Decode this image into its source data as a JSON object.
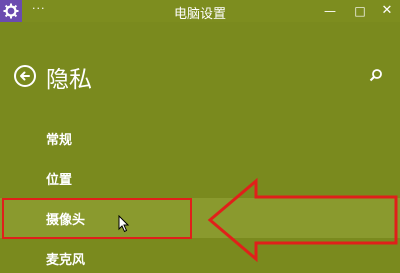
{
  "window": {
    "title": "电脑设置",
    "sys_menu": "···",
    "minimize": "—",
    "maximize": "□",
    "close": "✕"
  },
  "header": {
    "title": "隐私",
    "back_icon": "back-arrow-circle-icon",
    "search_icon": "search-icon"
  },
  "nav": {
    "items": [
      {
        "label": "常规"
      },
      {
        "label": "位置"
      },
      {
        "label": "摄像头",
        "selected": true
      },
      {
        "label": "麦克风"
      }
    ]
  },
  "annotation": {
    "box_color": "#e0201a",
    "arrow_color": "#e0201a"
  },
  "colors": {
    "background": "#7a8a1e",
    "selected_row": "#8a9a2e",
    "app_icon": "#6b4bb0"
  }
}
